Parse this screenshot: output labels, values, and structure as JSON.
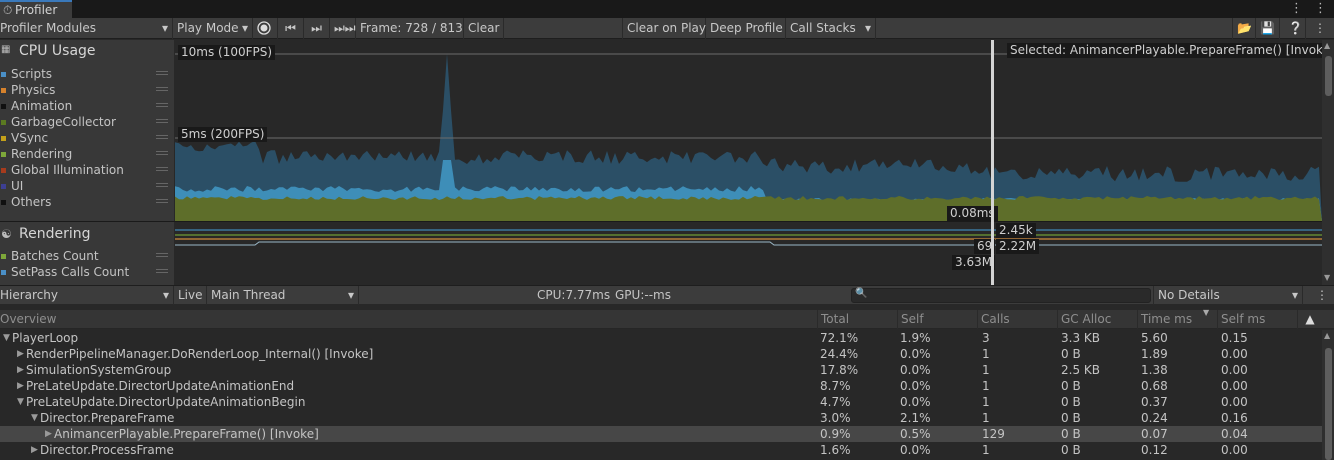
{
  "window": {
    "tab": "Profiler"
  },
  "toolbar": {
    "modules": "Profiler Modules",
    "play_mode": "Play Mode",
    "frame": "Frame: 728 / 813",
    "clear": "Clear",
    "clear_on_play": "Clear on Play",
    "deep_profile": "Deep Profile",
    "call_stacks": "Call Stacks"
  },
  "cpu_module": {
    "title": "CPU Usage",
    "legend": [
      {
        "label": "Scripts",
        "color": "#4a8fc6"
      },
      {
        "label": "Physics",
        "color": "#d6822c"
      },
      {
        "label": "Animation",
        "color": "#101010"
      },
      {
        "label": "GarbageCollector",
        "color": "#5b7a21"
      },
      {
        "label": "VSync",
        "color": "#c4a11a"
      },
      {
        "label": "Rendering",
        "color": "#7ea83a"
      },
      {
        "label": "Global Illumination",
        "color": "#a63b1d"
      },
      {
        "label": "UI",
        "color": "#3d3f93"
      },
      {
        "label": "Others",
        "color": "#101010"
      }
    ]
  },
  "rendering_module": {
    "title": "Rendering",
    "legend": [
      {
        "label": "Batches Count",
        "color": "#7ea83a"
      },
      {
        "label": "SetPass Calls Count",
        "color": "#4a8fc6"
      }
    ]
  },
  "chart_labels": {
    "line_10ms": "10ms (100FPS)",
    "line_5ms": "5ms (200FPS)",
    "selected": "Selected: AnimancerPlayable.PrepareFrame() [Invoke]",
    "cpu_value": "0.08ms",
    "r1": "2.45k",
    "r2a": "69",
    "r2b": "2.22M",
    "r3": "3.63M"
  },
  "details_toolbar": {
    "view": "Hierarchy",
    "live": "Live",
    "thread": "Main Thread",
    "cpu": "CPU:7.77ms",
    "gpu": "GPU:--ms",
    "details": "No Details"
  },
  "columns": [
    "Overview",
    "Total",
    "Self",
    "Calls",
    "GC Alloc",
    "Time ms",
    "Self ms"
  ],
  "rows": [
    {
      "name": "PlayerLoop",
      "total": "72.1%",
      "self": "1.9%",
      "calls": "3",
      "gc": "3.3 KB",
      "time": "5.60",
      "selfms": "0.15"
    },
    {
      "name": "RenderPipelineManager.DoRenderLoop_Internal() [Invoke]",
      "total": "24.4%",
      "self": "0.0%",
      "calls": "1",
      "gc": "0 B",
      "time": "1.89",
      "selfms": "0.00"
    },
    {
      "name": "SimulationSystemGroup",
      "total": "17.8%",
      "self": "0.0%",
      "calls": "1",
      "gc": "2.5 KB",
      "time": "1.38",
      "selfms": "0.00"
    },
    {
      "name": "PreLateUpdate.DirectorUpdateAnimationEnd",
      "total": "8.7%",
      "self": "0.0%",
      "calls": "1",
      "gc": "0 B",
      "time": "0.68",
      "selfms": "0.00"
    },
    {
      "name": "PreLateUpdate.DirectorUpdateAnimationBegin",
      "total": "4.7%",
      "self": "0.0%",
      "calls": "1",
      "gc": "0 B",
      "time": "0.37",
      "selfms": "0.00"
    },
    {
      "name": "Director.PrepareFrame",
      "total": "3.0%",
      "self": "2.1%",
      "calls": "1",
      "gc": "0 B",
      "time": "0.24",
      "selfms": "0.16"
    },
    {
      "name": "AnimancerPlayable.PrepareFrame() [Invoke]",
      "total": "0.9%",
      "self": "0.5%",
      "calls": "129",
      "gc": "0 B",
      "time": "0.07",
      "selfms": "0.04"
    },
    {
      "name": "Director.ProcessFrame",
      "total": "1.6%",
      "self": "0.0%",
      "calls": "1",
      "gc": "0 B",
      "time": "0.12",
      "selfms": "0.00"
    }
  ]
}
